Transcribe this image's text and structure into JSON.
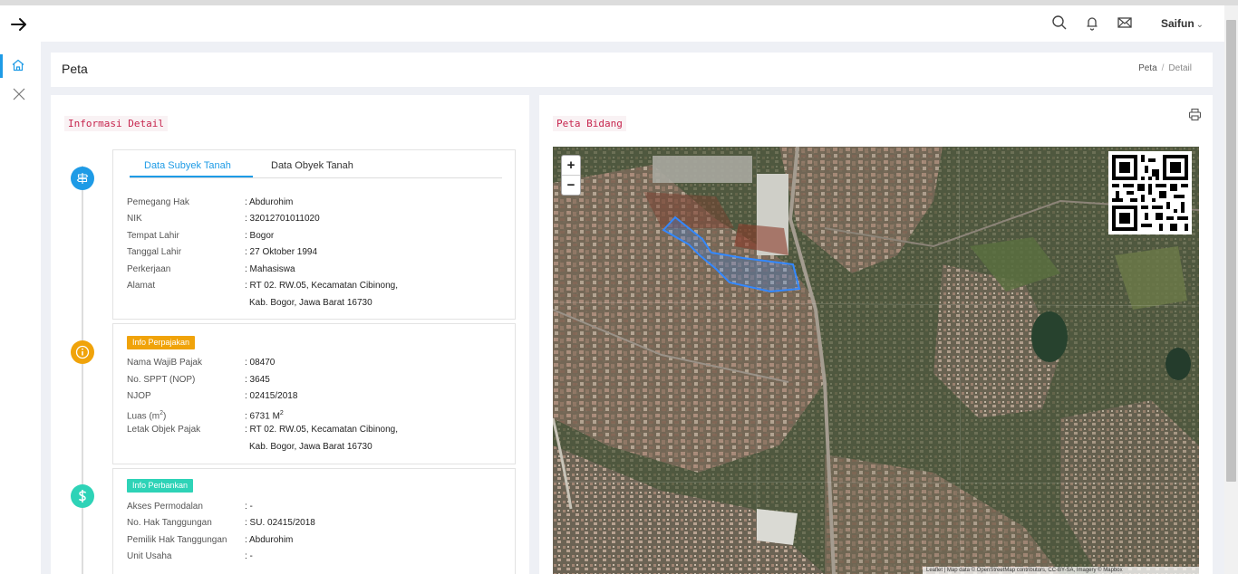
{
  "header": {
    "user_name": "Saifun",
    "icons": [
      "arrow-right-icon",
      "search-icon",
      "bell-icon",
      "mail-icon",
      "chevron-down-icon"
    ]
  },
  "sidebar": {
    "icons": [
      "home-icon",
      "close-icon"
    ]
  },
  "page": {
    "title": "Peta",
    "breadcrumb": [
      "Peta",
      "Detail"
    ]
  },
  "info_section": {
    "heading": "Informasi Detail",
    "tabs": [
      {
        "label": "Data Subyek Tanah",
        "active": true
      },
      {
        "label": "Data Obyek Tanah",
        "active": false
      }
    ],
    "subyek": {
      "rows": [
        {
          "label": "Pemegang Hak",
          "value": ": Abdurohim"
        },
        {
          "label": "NIK",
          "value": ": 32012701011020"
        },
        {
          "label": "Tempat Lahir",
          "value": ": Bogor"
        },
        {
          "label": "Tanggal Lahir",
          "value": ": 27 Oktober 1994"
        },
        {
          "label": "Perkerjaan",
          "value": ": Mahasiswa"
        },
        {
          "label": "Alamat",
          "value": ": RT 02. RW.05, Kecamatan Cibinong,"
        }
      ],
      "alamat_line2": "Kab. Bogor, Jawa Barat 16730"
    },
    "pajak": {
      "badge": "Info Perpajakan",
      "rows": [
        {
          "label": "Nama WajiB Pajak",
          "value": ": 08470"
        },
        {
          "label": "No. SPPT (NOP)",
          "value": ": 3645"
        },
        {
          "label": "NJOP",
          "value": ": 02415/2018"
        },
        {
          "label": "Luas (m",
          "label_sup": "2",
          "label_end": ")",
          "value": ": 6731 M",
          "value_sup": "2"
        },
        {
          "label": "Letak Objek Pajak",
          "value": ": RT 02. RW.05, Kecamatan Cibinong,"
        }
      ],
      "letak_line2": "Kab. Bogor, Jawa Barat 16730"
    },
    "perbankan": {
      "badge": "Info Perbankan",
      "rows": [
        {
          "label": "Akses Permodalan",
          "value": ": -"
        },
        {
          "label": "No. Hak Tanggungan",
          "value": ": SU. 02415/2018"
        },
        {
          "label": "Pemilik Hak Tanggungan",
          "value": ": Abdurohim"
        },
        {
          "label": "Unit Usaha",
          "value": ": -"
        }
      ]
    },
    "colors": {
      "accent": "#1e9be6",
      "pajak": "#f0a30a",
      "perbankan": "#2ed3b7"
    }
  },
  "map_section": {
    "heading": "Peta Bidang",
    "zoom_in": "+",
    "zoom_out": "−",
    "attribution": "Leaflet | Map data © OpenStreetMap contributors, CC-BY-SA, Imagery © Mapbox"
  }
}
